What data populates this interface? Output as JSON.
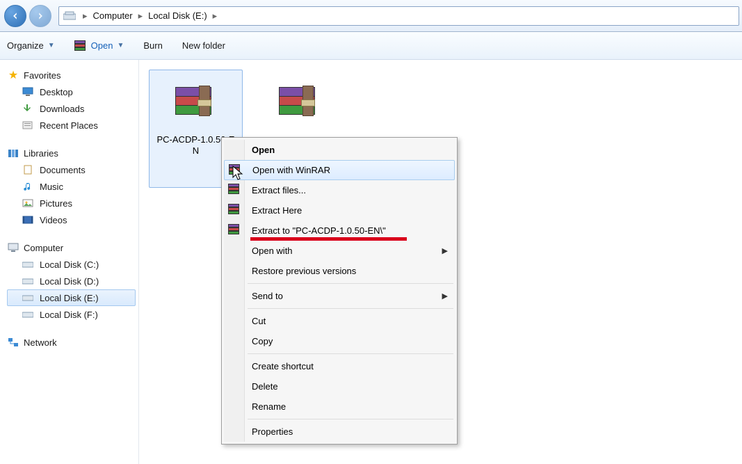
{
  "address": {
    "root": "Computer",
    "drive": "Local Disk (E:)"
  },
  "toolbar": {
    "organize": "Organize",
    "open": "Open",
    "burn": "Burn",
    "new_folder": "New folder"
  },
  "sidebar": {
    "favorites": {
      "head": "Favorites",
      "items": [
        "Desktop",
        "Downloads",
        "Recent Places"
      ]
    },
    "libraries": {
      "head": "Libraries",
      "items": [
        "Documents",
        "Music",
        "Pictures",
        "Videos"
      ]
    },
    "computer": {
      "head": "Computer",
      "items": [
        "Local Disk (C:)",
        "Local Disk (D:)",
        "Local Disk (E:)",
        "Local Disk (F:)"
      ],
      "selected_index": 2
    },
    "network": {
      "head": "Network"
    }
  },
  "files": [
    {
      "label": "PC-ACDP-1.0.50-EN",
      "selected": true
    },
    {
      "label": "",
      "selected": false
    }
  ],
  "context_menu": {
    "items": [
      {
        "text": "Open",
        "bold": true
      },
      {
        "text": "Open with WinRAR",
        "icon": "rar",
        "hover": true
      },
      {
        "text": "Extract files...",
        "icon": "rar"
      },
      {
        "text": "Extract Here",
        "icon": "rar"
      },
      {
        "text": "Extract to \"PC-ACDP-1.0.50-EN\\\"",
        "icon": "rar"
      },
      {
        "text": "Open with",
        "submenu": true
      },
      {
        "text": "Restore previous versions"
      },
      {
        "sep": true
      },
      {
        "text": "Send to",
        "submenu": true
      },
      {
        "sep": true
      },
      {
        "text": "Cut"
      },
      {
        "text": "Copy"
      },
      {
        "sep": true
      },
      {
        "text": "Create shortcut"
      },
      {
        "text": "Delete"
      },
      {
        "text": "Rename"
      },
      {
        "sep": true
      },
      {
        "text": "Properties"
      }
    ]
  }
}
